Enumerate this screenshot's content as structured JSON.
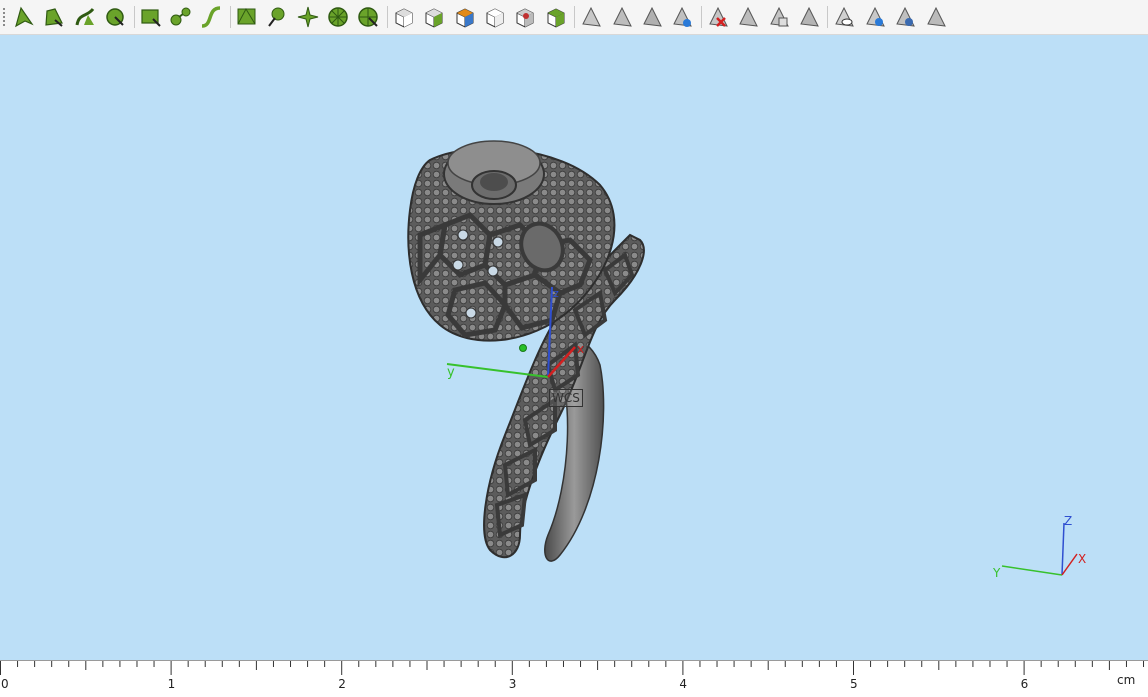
{
  "toolbar": {
    "groups": [
      [
        "point-arrow-icon",
        "fill-point-icon",
        "curve-arrow-icon",
        "circle-arrow-icon"
      ],
      [
        "rect-select-icon",
        "node-link-icon",
        "s-curve-icon"
      ],
      [
        "mesh-select-icon",
        "sphere-pin-icon",
        "cross-star-icon",
        "wheel-icon",
        "cut-wheel-icon"
      ],
      [
        "cube-view-icon",
        "cube-front-icon",
        "cube-top-icon",
        "cube-wire-icon",
        "cube-red-icon",
        "cube-grid-icon"
      ],
      [
        "tri-point-icon",
        "tri-edge-icon",
        "tri-face-icon",
        "tri-blue-icon"
      ],
      [
        "tri-remove-icon",
        "tri-split-icon",
        "tri-copy-icon",
        "tri-flip-icon"
      ],
      [
        "tri-eye-icon",
        "tri-eye-blue-icon",
        "tri-eye-fill-icon",
        "tri-hide-icon"
      ]
    ]
  },
  "viewport": {
    "background": "#bcdff7",
    "model_color": "#5f5f5f",
    "wcs_label": "WCS",
    "axes": {
      "x": "x",
      "y": "y",
      "z": "z"
    },
    "mini_axes": {
      "x": "X",
      "y": "Y",
      "z": "Z"
    }
  },
  "ruler": {
    "labels": [
      "0",
      "1",
      "2",
      "3",
      "4",
      "5",
      "6"
    ],
    "unit": "cm"
  }
}
